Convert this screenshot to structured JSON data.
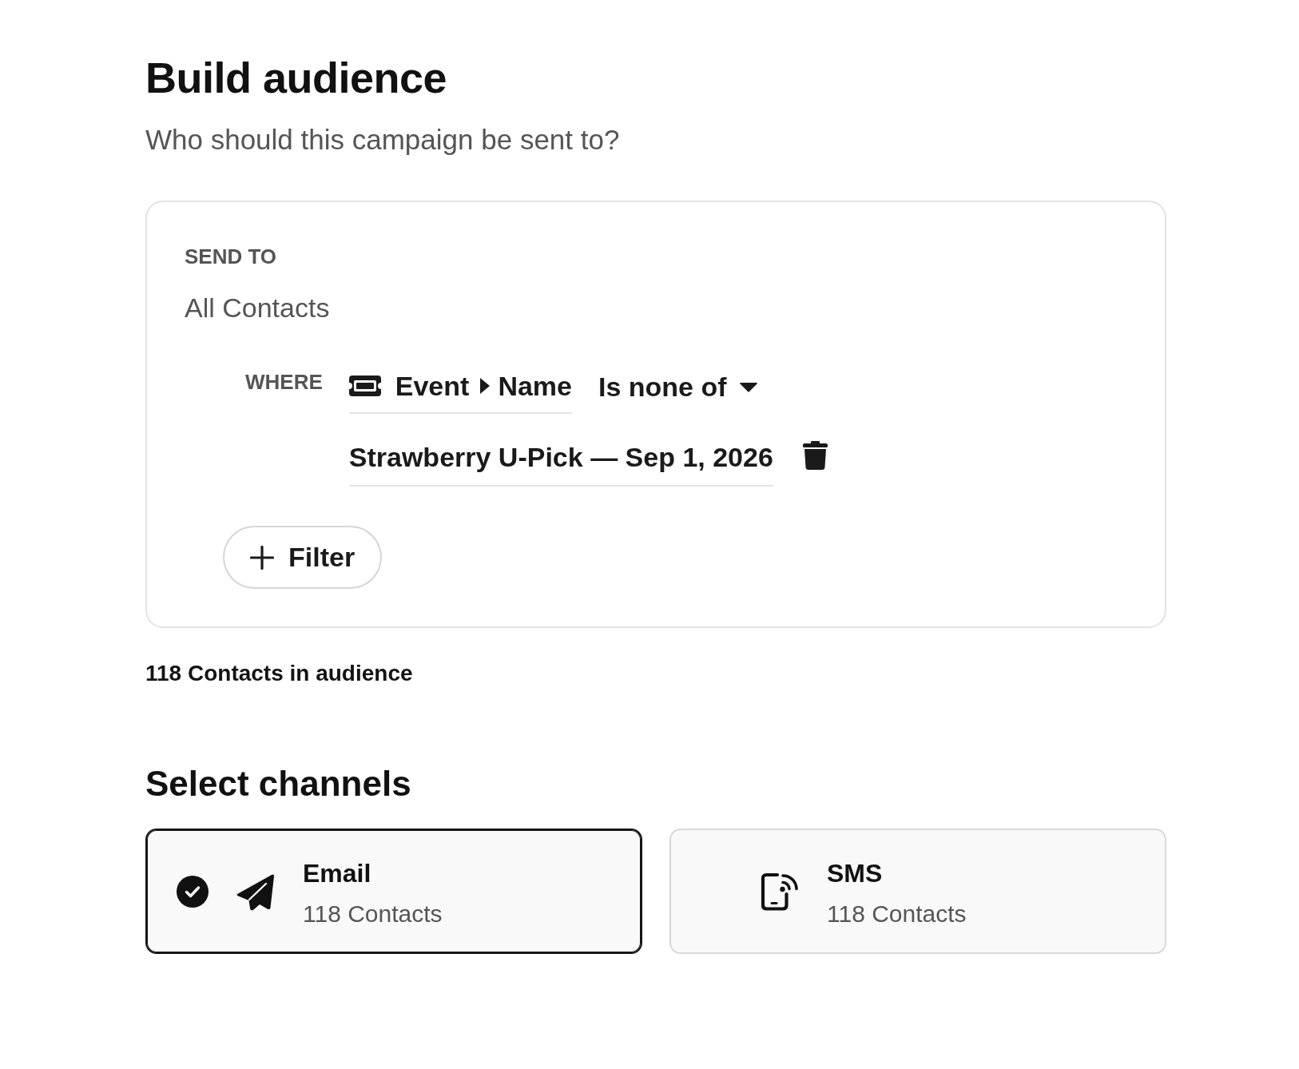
{
  "header": {
    "title": "Build audience",
    "subtitle": "Who should this campaign be sent to?"
  },
  "audience": {
    "send_to_label": "SEND TO",
    "send_to_value": "All Contacts",
    "filters": [
      {
        "where_label": "WHERE",
        "field": {
          "object": "Event",
          "attribute": "Name"
        },
        "operator": "Is none of",
        "values": [
          "Strawberry U-Pick — Sep 1, 2026"
        ]
      }
    ],
    "add_filter_button": "Filter"
  },
  "audience_count": "118 Contacts in audience",
  "channels_section": {
    "title": "Select channels",
    "channels": [
      {
        "kind": "email",
        "name": "Email",
        "count": "118 Contacts",
        "selected": true
      },
      {
        "kind": "sms",
        "name": "SMS",
        "count": "118 Contacts",
        "selected": false
      }
    ]
  }
}
